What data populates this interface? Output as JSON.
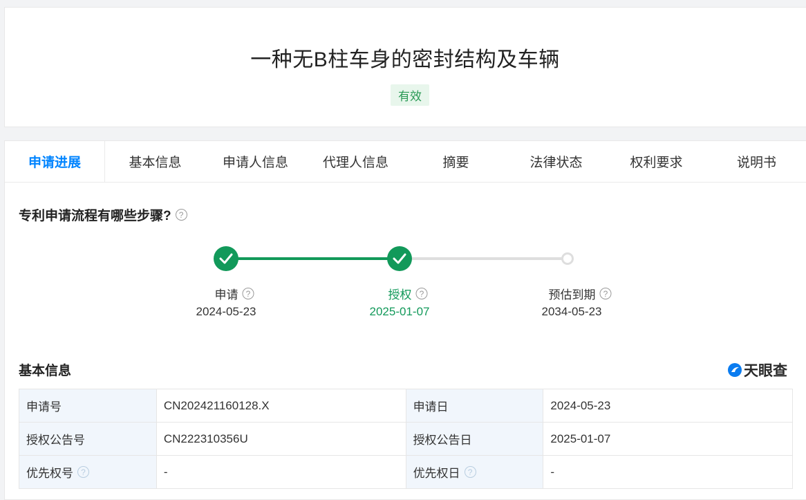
{
  "header": {
    "title": "一种无B柱车身的密封结构及车辆",
    "status": "有效"
  },
  "tabs": [
    {
      "label": "申请进展",
      "active": true
    },
    {
      "label": "基本信息",
      "active": false
    },
    {
      "label": "申请人信息",
      "active": false
    },
    {
      "label": "代理人信息",
      "active": false
    },
    {
      "label": "摘要",
      "active": false
    },
    {
      "label": "法律状态",
      "active": false
    },
    {
      "label": "权利要求",
      "active": false
    },
    {
      "label": "说明书",
      "active": false
    }
  ],
  "progress": {
    "title": "专利申请流程有哪些步骤?",
    "help": "?",
    "steps": [
      {
        "label": "申请",
        "date": "2024-05-23",
        "state": "done"
      },
      {
        "label": "授权",
        "date": "2025-01-07",
        "state": "done"
      },
      {
        "label": "预估到期",
        "date": "2034-05-23",
        "state": "pending"
      }
    ]
  },
  "basic_info": {
    "title": "基本信息",
    "brand": "天眼查",
    "rows": [
      [
        {
          "label": "申请号",
          "value": "CN202421160128.X"
        },
        {
          "label": "申请日",
          "value": "2024-05-23"
        }
      ],
      [
        {
          "label": "授权公告号",
          "value": "CN222310356U"
        },
        {
          "label": "授权公告日",
          "value": "2025-01-07"
        }
      ],
      [
        {
          "label": "优先权号",
          "value": "-",
          "help": true
        },
        {
          "label": "优先权日",
          "value": "-",
          "help": true
        }
      ]
    ]
  },
  "colors": {
    "accent": "#0084ff",
    "success": "#12995a",
    "badge_bg": "#e8f6ec",
    "label_bg": "#f1f6fc"
  }
}
